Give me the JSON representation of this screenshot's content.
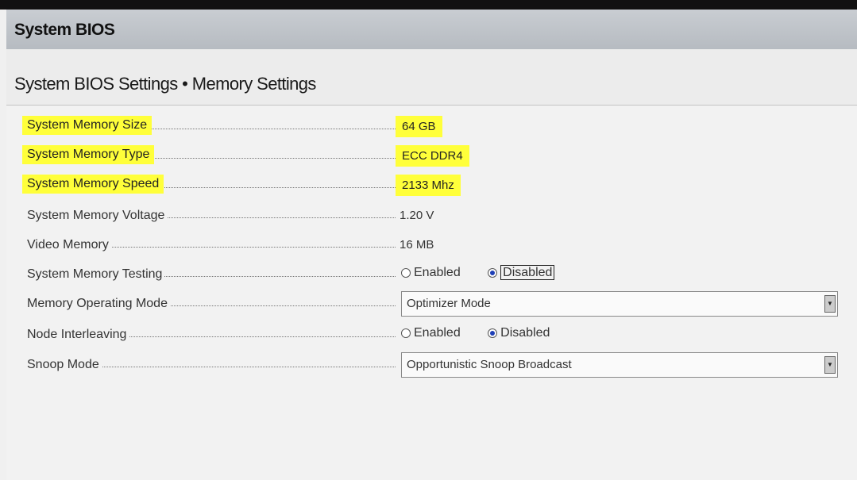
{
  "window": {
    "title": "System BIOS"
  },
  "page": {
    "breadcrumb": "System BIOS Settings • Memory Settings"
  },
  "settings": [
    {
      "label": "System Memory Size",
      "value": "64 GB",
      "highlighted": true
    },
    {
      "label": "System Memory Type",
      "value": "ECC DDR4",
      "highlighted": true
    },
    {
      "label": "System Memory Speed",
      "value": "2133 Mhz",
      "highlighted": true
    },
    {
      "label": "System Memory Voltage",
      "value": "1.20 V",
      "highlighted": false
    },
    {
      "label": "Video Memory",
      "value": "16 MB",
      "highlighted": false
    }
  ],
  "memory_testing": {
    "label": "System Memory Testing",
    "enabled_label": "Enabled",
    "disabled_label": "Disabled",
    "selected": "Disabled"
  },
  "operating_mode": {
    "label": "Memory Operating Mode",
    "value": "Optimizer Mode"
  },
  "node_interleaving": {
    "label": "Node Interleaving",
    "enabled_label": "Enabled",
    "disabled_label": "Disabled",
    "selected": "Disabled"
  },
  "snoop_mode": {
    "label": "Snoop Mode",
    "value": "Opportunistic Snoop Broadcast"
  },
  "colors": {
    "highlight": "#ffff3a",
    "radio_selected": "#1e3fb6"
  }
}
